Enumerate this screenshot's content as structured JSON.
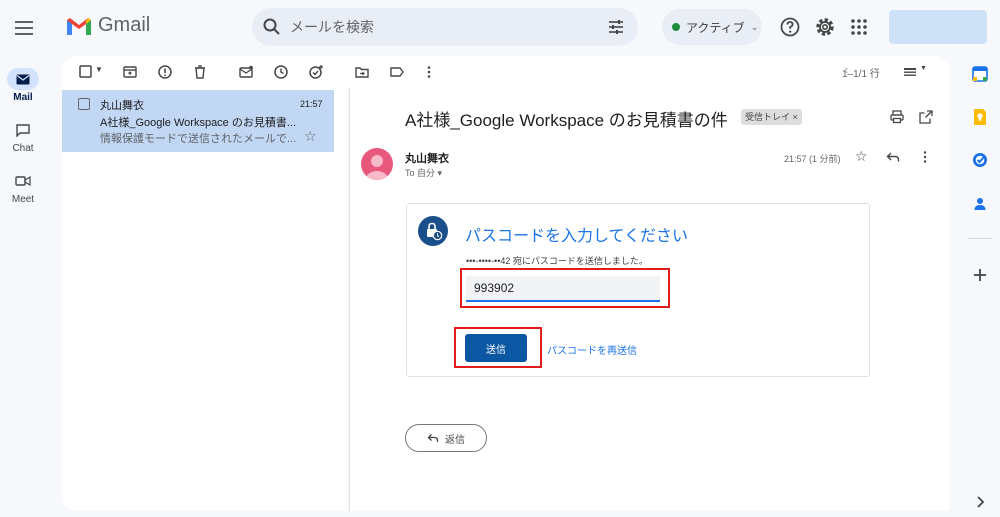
{
  "header": {
    "app_name": "Gmail",
    "search_placeholder": "メールを検索",
    "status_label": "アクティブ"
  },
  "rail": {
    "items": [
      {
        "label": "Mail"
      },
      {
        "label": "Chat"
      },
      {
        "label": "Meet"
      }
    ]
  },
  "toolbar": {
    "pager": "1–1/1 行"
  },
  "mail_list": {
    "items": [
      {
        "sender": "丸山舞衣",
        "time": "21:57",
        "subject": "A社様_Google Workspace のお見積書...",
        "snippet": "情報保護モードで送信されたメールで..."
      }
    ]
  },
  "message": {
    "subject": "A社様_Google Workspace のお見積書の件",
    "label": "受信トレイ ×",
    "sender": "丸山舞衣",
    "recipient": "To 自分 ▾",
    "time": "21:57 (1 分前)"
  },
  "passcode": {
    "title": "パスコードを入力してください",
    "description": "•••-••••-••42 宛にパスコードを送信しました。",
    "value": "993902",
    "submit_label": "送信",
    "resend_label": "パスコードを再送信"
  },
  "reply": {
    "label": "返信"
  },
  "colors": {
    "accent": "#1a73e8",
    "button": "#0b57a4",
    "highlight": "#e11d1d",
    "selected_row": "#c2d7f3"
  }
}
